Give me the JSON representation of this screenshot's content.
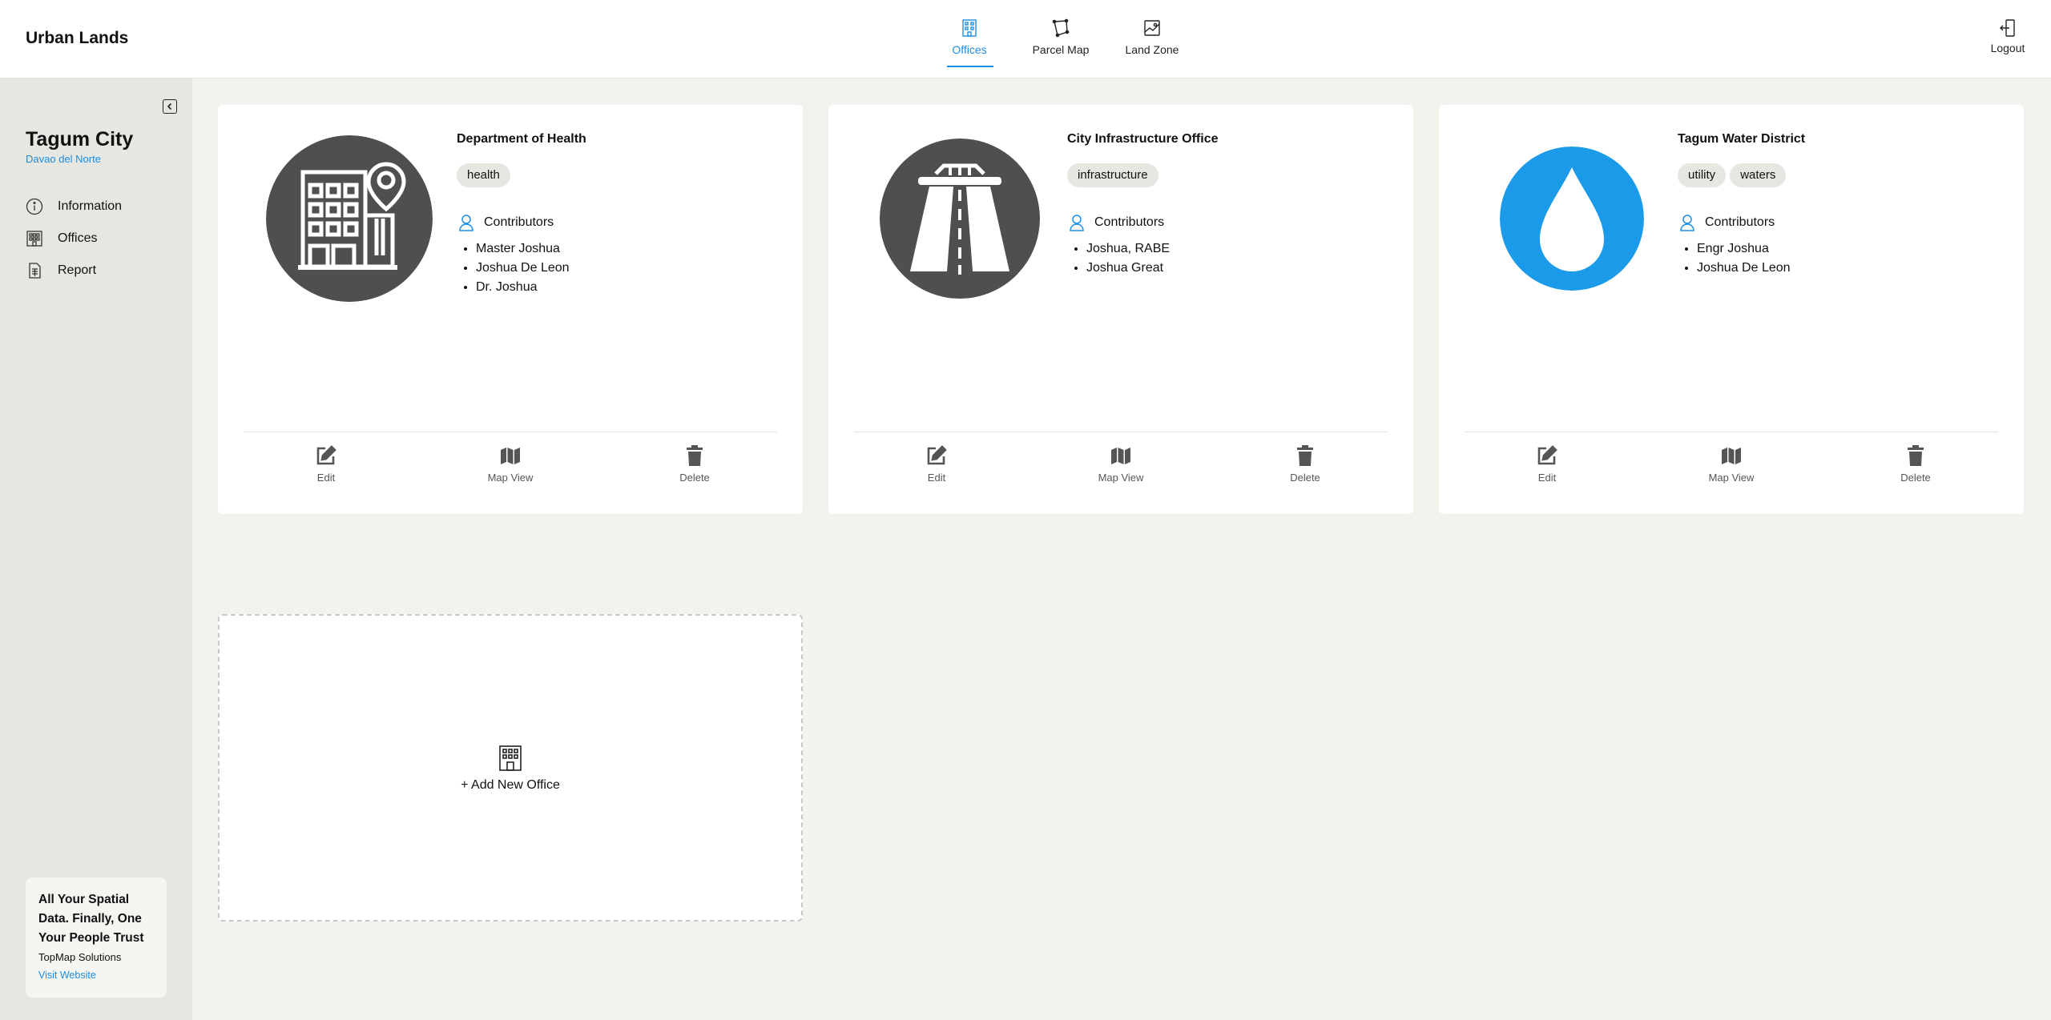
{
  "header": {
    "brand": "Urban Lands",
    "nav": [
      {
        "label": "Offices",
        "icon": "office-building-icon",
        "active": true
      },
      {
        "label": "Parcel Map",
        "icon": "parcel-polygon-icon",
        "active": false
      },
      {
        "label": "Land Zone",
        "icon": "land-zone-icon",
        "active": false
      }
    ],
    "logout_label": "Logout"
  },
  "sidebar": {
    "city": "Tagum City",
    "province": "Davao del Norte",
    "items": [
      {
        "label": "Information",
        "icon": "info-icon"
      },
      {
        "label": "Offices",
        "icon": "office-building-icon"
      },
      {
        "label": "Report",
        "icon": "report-icon"
      }
    ],
    "promo": {
      "title": "All Your Spatial Data. Finally, One Your People Trust",
      "company": "TopMap Solutions",
      "link": "Visit Website"
    }
  },
  "offices": [
    {
      "title": "Department of Health",
      "tags": [
        "health"
      ],
      "contributors_label": "Contributors",
      "contributors": [
        "Master Joshua",
        "Joshua De Leon",
        "Dr. Joshua"
      ],
      "logo_icon": "hospital-building-icon",
      "logo_color": "#4f4f4f"
    },
    {
      "title": "City Infrastructure Office",
      "tags": [
        "infrastructure"
      ],
      "contributors_label": "Contributors",
      "contributors": [
        "Joshua, RABE",
        "Joshua Great"
      ],
      "logo_icon": "road-icon",
      "logo_color": "#4f4f4f"
    },
    {
      "title": "Tagum Water District",
      "tags": [
        "utility",
        "waters"
      ],
      "contributors_label": "Contributors",
      "contributors": [
        "Engr Joshua",
        "Joshua De Leon"
      ],
      "logo_icon": "water-drop-icon",
      "logo_color": "#1a9ae8"
    }
  ],
  "card_actions": {
    "edit": "Edit",
    "map_view": "Map View",
    "delete": "Delete"
  },
  "add_office_label": "+ Add New Office",
  "colors": {
    "accent": "#1a8ee6",
    "sidebar_bg": "#e7e7e1",
    "page_bg": "#f3f3ee"
  }
}
